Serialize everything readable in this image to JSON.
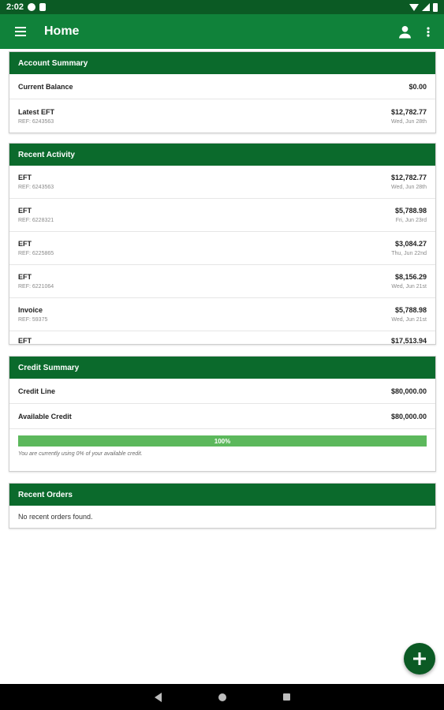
{
  "status_bar": {
    "time": "2:02",
    "left_icons": [
      "app-notification-icon",
      "doc-notification-icon"
    ],
    "right_icons": [
      "wifi-icon",
      "signal-icon",
      "battery-icon"
    ]
  },
  "app_bar": {
    "title": "Home",
    "menu_icon": "hamburger-menu-icon",
    "profile_icon": "account-icon",
    "overflow_icon": "more-vert-icon",
    "color": "#10823a"
  },
  "account_summary": {
    "title": "Account Summary",
    "current_balance_label": "Current Balance",
    "current_balance_value": "$0.00",
    "latest_eft_label": "Latest EFT",
    "latest_eft_ref": "REF: 6243563",
    "latest_eft_amount": "$12,782.77",
    "latest_eft_date": "Wed, Jun 28th"
  },
  "recent_activity": {
    "title": "Recent Activity",
    "items": [
      {
        "type": "EFT",
        "ref": "REF: 6243563",
        "amount": "$12,782.77",
        "date": "Wed, Jun 28th"
      },
      {
        "type": "EFT",
        "ref": "REF: 6228321",
        "amount": "$5,788.98",
        "date": "Fri, Jun 23rd"
      },
      {
        "type": "EFT",
        "ref": "REF: 6225865",
        "amount": "$3,084.27",
        "date": "Thu, Jun 22nd"
      },
      {
        "type": "EFT",
        "ref": "REF: 6221064",
        "amount": "$8,156.29",
        "date": "Wed, Jun 21st"
      },
      {
        "type": "Invoice",
        "ref": "REF: 59375",
        "amount": "$5,788.98",
        "date": "Wed, Jun 21st"
      },
      {
        "type": "EFT",
        "ref": "",
        "amount": "$17,513.94",
        "date": ""
      }
    ]
  },
  "credit_summary": {
    "title": "Credit Summary",
    "credit_line_label": "Credit Line",
    "credit_line_value": "$80,000.00",
    "available_credit_label": "Available Credit",
    "available_credit_value": "$80,000.00",
    "progress_percent": 100,
    "progress_label": "100%",
    "note": "You are currently using 0% of your available credit."
  },
  "recent_orders": {
    "title": "Recent Orders",
    "empty_message": "No recent orders found."
  },
  "fab": {
    "icon": "plus-icon"
  },
  "nav_bar": {
    "icons": [
      "back-icon",
      "home-icon",
      "recents-icon"
    ]
  },
  "colors": {
    "header": "#0b6a2c",
    "progress": "#5cb85c",
    "fab": "#0b5a24"
  }
}
